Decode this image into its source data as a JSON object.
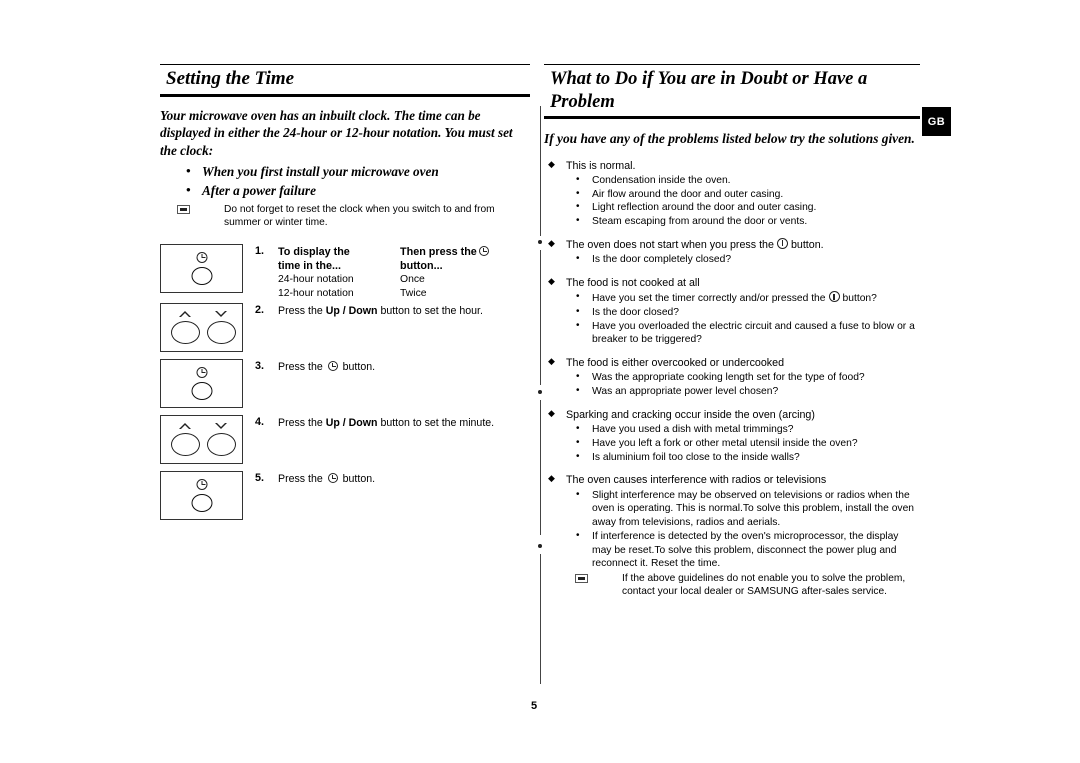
{
  "page": {
    "number": "5",
    "locale_badge": "GB"
  },
  "left_column": {
    "heading": "Setting the Time",
    "lead": "Your microwave oven has an inbuilt clock. The time can be displayed in either the 24-hour or 12-hour notation. You must set the clock:",
    "bullets": [
      "When you first install your microwave oven",
      "After a power failure"
    ],
    "note": "Do not forget to reset the clock when you switch to and from summer or winter time.",
    "steps": [
      {
        "number": "1.",
        "key_icon": "clock-key",
        "table": {
          "headers": [
            "To display the time in the...",
            "Then press the ⓵ button..."
          ],
          "header_col1": "To display the",
          "header_col1_line2": "time in the...",
          "header_col2_pre": "Then press the",
          "header_col2_post": "button...",
          "rows": [
            [
              "24-hour notation",
              "Once"
            ],
            [
              "12-hour notation",
              "Twice"
            ]
          ]
        }
      },
      {
        "number": "2.",
        "key_icon": "up-down-keys",
        "text_pre": "Press the ",
        "text_bold": "Up / Down",
        "text_post": " button to set the hour."
      },
      {
        "number": "3.",
        "key_icon": "clock-key",
        "text_pre": "Press the ",
        "text_post": " button."
      },
      {
        "number": "4.",
        "key_icon": "up-down-keys",
        "text_pre": "Press the ",
        "text_bold": "Up / Down",
        "text_post": " button to set the minute."
      },
      {
        "number": "5.",
        "key_icon": "clock-key",
        "text_pre": "Press the ",
        "text_post": " button."
      }
    ]
  },
  "right_column": {
    "heading": "What to Do if You are in Doubt or Have a Problem",
    "lead": "If you have any of the problems listed below try the solutions given.",
    "groups": [
      {
        "title": "This is normal.",
        "items": [
          "Condensation inside the oven.",
          "Air flow around the door and outer casing.",
          "Light reflection around the door and outer casing.",
          "Steam escaping from around the door or vents."
        ]
      },
      {
        "title_pre": "The oven does not start when you press the",
        "title_post": "button.",
        "has_start_icon": true,
        "items": [
          "Is the door completely closed?"
        ]
      },
      {
        "title": "The food is not cooked at all",
        "items_rich": [
          {
            "pre": "Have you set the timer correctly and/or pressed the",
            "icon": "start",
            "post": "button?"
          },
          {
            "pre": "Is the door closed?"
          },
          {
            "pre": "Have you overloaded the electric circuit and caused a fuse to blow or a breaker to be triggered?"
          }
        ]
      },
      {
        "title": "The food is either overcooked or undercooked",
        "items": [
          "Was the appropriate cooking length set for the type of food?",
          "Was an appropriate power level chosen?"
        ]
      },
      {
        "title": "Sparking and cracking occur inside the oven (arcing)",
        "items": [
          "Have you used a dish with metal trimmings?",
          "Have you left a fork or other metal utensil inside the oven?",
          "Is aluminium foil too close to the inside walls?"
        ]
      },
      {
        "title": "The oven causes interference with radios or televisions",
        "items": [
          "Slight interference may be observed on televisions or radios when the oven is operating. This is normal.To solve this problem, install the oven away from televisions, radios and aerials.",
          "If interference is detected by the oven's microprocessor, the display may be reset.To solve this problem, disconnect the power plug and reconnect it. Reset the time."
        ],
        "note": "If the above guidelines do not enable you to solve the problem, contact your local dealer or SAMSUNG after-sales service."
      }
    ]
  }
}
